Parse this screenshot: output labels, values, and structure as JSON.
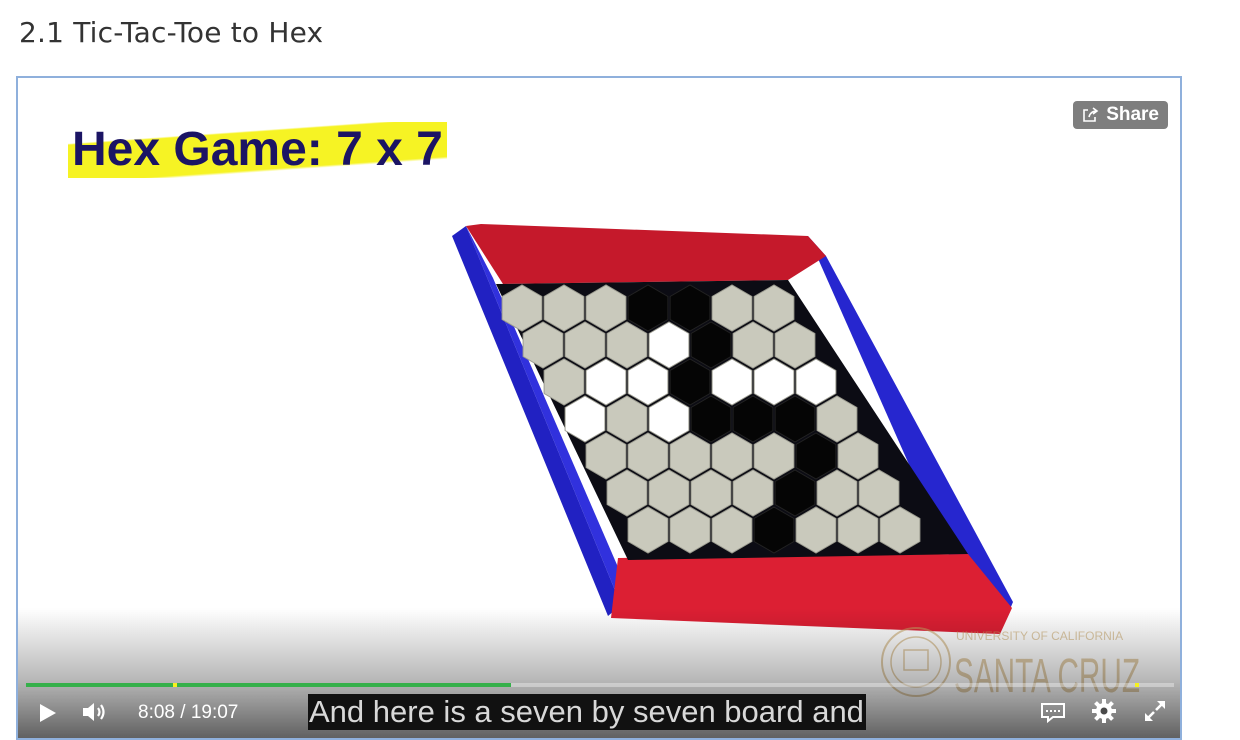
{
  "page": {
    "title": "2.1 Tic-Tac-Toe to Hex"
  },
  "video": {
    "slide_title": "Hex Game: 7 x 7",
    "share_label": "Share",
    "current_time": "8:08",
    "time_separator": " / ",
    "duration": "19:07",
    "progress_fraction": 0.4227,
    "chapter_markers": [
      0.128,
      0.966
    ],
    "caption": "And here is a seven by seven board and",
    "logo": {
      "line1": "UNIVERSITY OF CALIFORNIA",
      "line2": "SANTA CRUZ"
    },
    "board": {
      "rows": 7,
      "cols": 7,
      "cells": [
        "eeebbee",
        "eeewbee",
        "ewwbwww",
        "wewbbbe",
        "eeeeebe",
        "eeeebee",
        "eeebeee"
      ],
      "legend": "e = empty, w = white stone, b = black stone"
    },
    "controls": {
      "play": "play-icon",
      "volume": "volume-icon",
      "captions": "closed-captions-icon",
      "settings": "gear-icon",
      "fullscreen": "fullscreen-icon"
    }
  },
  "colors": {
    "red_edge": "#d21b30",
    "blue_edge": "#2323c8",
    "empty_hex": "#c9c9bc",
    "white_hex": "#ffffff",
    "black_hex": "#050505",
    "progress": "#35b04a",
    "marker": "#f5f11e"
  }
}
